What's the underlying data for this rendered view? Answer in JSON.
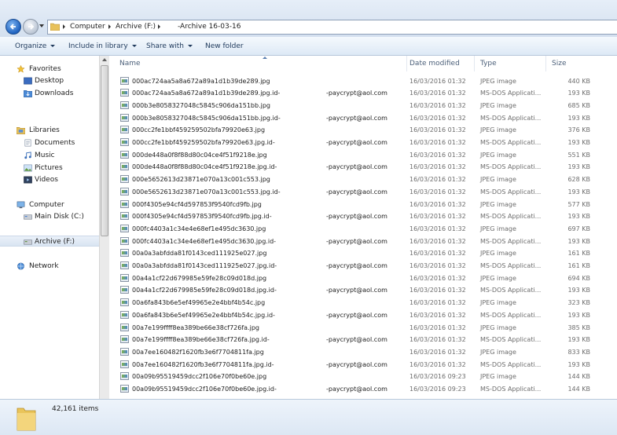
{
  "address": {
    "crumbs": [
      "Computer",
      "Archive (F:)",
      "-Archive 16-03-16"
    ]
  },
  "toolbar": {
    "organize": "Organize",
    "include_in_library": "Include in library",
    "share_with": "Share with",
    "new_folder": "New folder"
  },
  "nav": {
    "favorites": "Favorites",
    "desktop": "Desktop",
    "downloads": "Downloads",
    "libraries": "Libraries",
    "documents": "Documents",
    "music": "Music",
    "pictures": "Pictures",
    "videos": "Videos",
    "computer": "Computer",
    "main_disk": "Main Disk (C:)",
    "archive": "Archive (F:)",
    "network": "Network"
  },
  "columns": {
    "name": "Name",
    "date": "Date modified",
    "type": "Type",
    "size": "Size"
  },
  "files": [
    {
      "name": "000ac724aa5a8a672a89a1d1b39de289.jpg",
      "email": "",
      "date": "16/03/2016 01:32",
      "type": "JPEG image",
      "size": "440 KB"
    },
    {
      "name": "000ac724aa5a8a672a89a1d1b39de289.jpg.id-",
      "email": "-paycrypt@aol.com",
      "date": "16/03/2016 01:32",
      "type": "MS-DOS Applicati...",
      "size": "193 KB"
    },
    {
      "name": "000b3e8058327048c5845c906da151bb.jpg",
      "email": "",
      "date": "16/03/2016 01:32",
      "type": "JPEG image",
      "size": "685 KB"
    },
    {
      "name": "000b3e8058327048c5845c906da151bb.jpg.id-",
      "email": "-paycrypt@aol.com",
      "date": "16/03/2016 01:32",
      "type": "MS-DOS Applicati...",
      "size": "193 KB"
    },
    {
      "name": "000cc2fe1bbf459259502bfa79920e63.jpg",
      "email": "",
      "date": "16/03/2016 01:32",
      "type": "JPEG image",
      "size": "376 KB"
    },
    {
      "name": "000cc2fe1bbf459259502bfa79920e63.jpg.id-",
      "email": "-paycrypt@aol.com",
      "date": "16/03/2016 01:32",
      "type": "MS-DOS Applicati...",
      "size": "193 KB"
    },
    {
      "name": "000de448a0f8f88d80c04ce4f51f9218e.jpg",
      "email": "",
      "date": "16/03/2016 01:32",
      "type": "JPEG image",
      "size": "551 KB"
    },
    {
      "name": "000de448a0f8f88d80c04ce4f51f9218e.jpg.id-",
      "email": "-paycrypt@aol.com",
      "date": "16/03/2016 01:32",
      "type": "MS-DOS Applicati...",
      "size": "193 KB"
    },
    {
      "name": "000e5652613d23871e070a13c001c553.jpg",
      "email": "",
      "date": "16/03/2016 01:32",
      "type": "JPEG image",
      "size": "628 KB"
    },
    {
      "name": "000e5652613d23871e070a13c001c553.jpg.id-",
      "email": "-paycrypt@aol.com",
      "date": "16/03/2016 01:32",
      "type": "MS-DOS Applicati...",
      "size": "193 KB"
    },
    {
      "name": "000f4305e94cf4d597853f9540fcd9fb.jpg",
      "email": "",
      "date": "16/03/2016 01:32",
      "type": "JPEG image",
      "size": "577 KB"
    },
    {
      "name": "000f4305e94cf4d597853f9540fcd9fb.jpg.id-",
      "email": "-paycrypt@aol.com",
      "date": "16/03/2016 01:32",
      "type": "MS-DOS Applicati...",
      "size": "193 KB"
    },
    {
      "name": "000fc4403a1c34e4e68ef1e495dc3630.jpg",
      "email": "",
      "date": "16/03/2016 01:32",
      "type": "JPEG image",
      "size": "697 KB"
    },
    {
      "name": "000fc4403a1c34e4e68ef1e495dc3630.jpg.id-",
      "email": "-paycrypt@aol.com",
      "date": "16/03/2016 01:32",
      "type": "MS-DOS Applicati...",
      "size": "193 KB"
    },
    {
      "name": "00a0a3abfdda81f0143ced111925e027.jpg",
      "email": "",
      "date": "16/03/2016 01:32",
      "type": "JPEG image",
      "size": "161 KB"
    },
    {
      "name": "00a0a3abfdda81f0143ced111925e027.jpg.id-",
      "email": "-paycrypt@aol.com",
      "date": "16/03/2016 01:32",
      "type": "MS-DOS Applicati...",
      "size": "161 KB"
    },
    {
      "name": "00a4a1cf22d679985e59fe28c09d018d.jpg",
      "email": "",
      "date": "16/03/2016 01:32",
      "type": "JPEG image",
      "size": "694 KB"
    },
    {
      "name": "00a4a1cf22d679985e59fe28c09d018d.jpg.id-",
      "email": "-paycrypt@aol.com",
      "date": "16/03/2016 01:32",
      "type": "MS-DOS Applicati...",
      "size": "193 KB"
    },
    {
      "name": "00a6fa843b6e5ef49965e2e4bbf4b54c.jpg",
      "email": "",
      "date": "16/03/2016 01:32",
      "type": "JPEG image",
      "size": "323 KB"
    },
    {
      "name": "00a6fa843b6e5ef49965e2e4bbf4b54c.jpg.id-",
      "email": "-paycrypt@aol.com",
      "date": "16/03/2016 01:32",
      "type": "MS-DOS Applicati...",
      "size": "193 KB"
    },
    {
      "name": "00a7e199ffff8ea389be66e38cf726fa.jpg",
      "email": "",
      "date": "16/03/2016 01:32",
      "type": "JPEG image",
      "size": "385 KB"
    },
    {
      "name": "00a7e199ffff8ea389be66e38cf726fa.jpg.id-",
      "email": "-paycrypt@aol.com",
      "date": "16/03/2016 01:32",
      "type": "MS-DOS Applicati...",
      "size": "193 KB"
    },
    {
      "name": "00a7ee160482f1620fb3e6f7704811fa.jpg",
      "email": "",
      "date": "16/03/2016 01:32",
      "type": "JPEG image",
      "size": "833 KB"
    },
    {
      "name": "00a7ee160482f1620fb3e6f7704811fa.jpg.id-",
      "email": "-paycrypt@aol.com",
      "date": "16/03/2016 01:32",
      "type": "MS-DOS Applicati...",
      "size": "193 KB"
    },
    {
      "name": "00a09b95519459dcc2f106e70f0be60e.jpg",
      "email": "",
      "date": "16/03/2016 09:23",
      "type": "JPEG image",
      "size": "144 KB"
    },
    {
      "name": "00a09b95519459dcc2f106e70f0be60e.jpg.id-",
      "email": "-paycrypt@aol.com",
      "date": "16/03/2016 09:23",
      "type": "MS-DOS Applicati...",
      "size": "144 KB"
    }
  ],
  "status": {
    "item_count": "42,161 items"
  }
}
